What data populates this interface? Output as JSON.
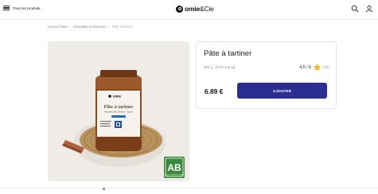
{
  "header": {
    "menu_label": "Tous les produits",
    "logo_bold": "omie",
    "logo_light": "&Cie",
    "icons": [
      "menu-icon",
      "search-icon",
      "user-icon"
    ]
  },
  "breadcrumb": {
    "items": [
      "Accueil Omie",
      "Chocolats et douceurs",
      "Pâte à tartiner"
    ],
    "separator": "/"
  },
  "jar": {
    "brand": "omie",
    "name": "Pâte à tartiner",
    "subtitle": "Noisettes des Landes + Cacao",
    "badge": "Bio"
  },
  "product": {
    "title": "Pâte à tartiner",
    "details": "300 g - 22.97 € le kg",
    "rating": "4,5 / 5",
    "review_count": "(35)",
    "price": "6.89 €",
    "add_label": "AJOUTER"
  },
  "organic_label": {
    "text": "AB",
    "subtext": "AGRICULTURE BIOLOGIQUE"
  },
  "colors": {
    "primary": "#2a2e8f",
    "star": "#f5b623",
    "organic_green": "#3b8a3c",
    "photo_bg": "#efece8"
  }
}
